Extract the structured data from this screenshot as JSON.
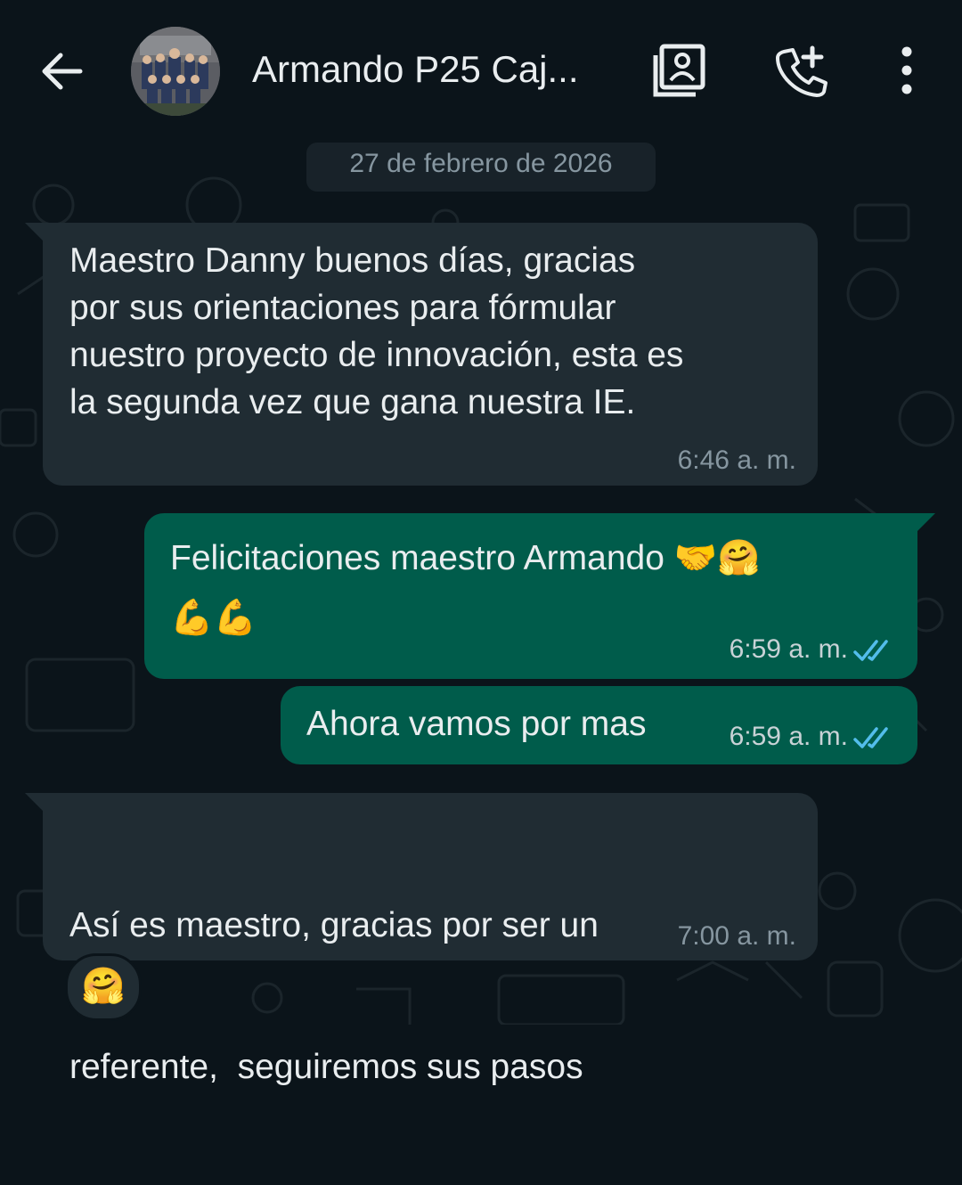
{
  "header": {
    "contact_name": "Armando P25 Caj...",
    "back_icon": "arrow-left-icon",
    "avatar_icon": "group-photo-avatar",
    "action_icons": [
      "contact-card-icon",
      "add-call-icon",
      "more-vertical-icon"
    ]
  },
  "date_chip": "27 de febrero de 2026",
  "messages": [
    {
      "direction": "incoming",
      "lines": [
        "Maestro Danny buenos días, gracias",
        "por sus orientaciones para fórmular",
        "nuestro proyecto de innovación, esta es",
        "la segunda vez que gana nuestra IE."
      ],
      "time": "6:46 a. m."
    },
    {
      "direction": "outgoing",
      "lines": [
        "Felicitaciones maestro Armando 🤝🤗",
        "💪💪"
      ],
      "time": "6:59 a. m.",
      "status": "read"
    },
    {
      "direction": "outgoing",
      "lines": [
        "Ahora vamos por mas"
      ],
      "time": "6:59 a. m.",
      "status": "read"
    },
    {
      "direction": "incoming",
      "lines": [
        "Así es maestro, gracias por ser un",
        "referente,  seguiremos sus pasos"
      ],
      "time": "7:00 a. m.",
      "reaction": "🤗"
    }
  ],
  "colors": {
    "background": "#0b141a",
    "incoming_bubble": "#202c33",
    "outgoing_bubble": "#005c4b",
    "read_ticks": "#53bdeb",
    "meta_text": "#8696a0"
  }
}
